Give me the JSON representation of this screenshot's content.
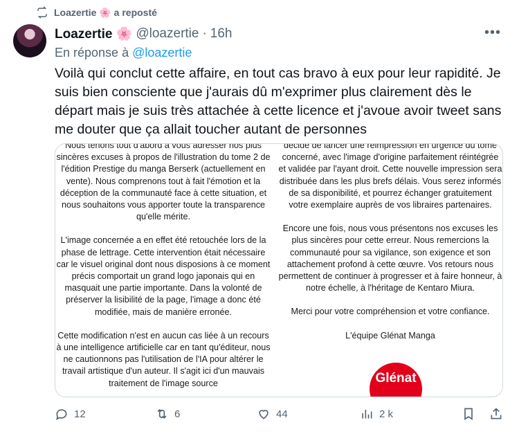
{
  "repost": {
    "label": "Loazertie 🌸 a reposté"
  },
  "post": {
    "display_name": "Loazertie 🌸",
    "handle": "@loazertie",
    "separator": "·",
    "time": "16h",
    "reply_prefix": "En réponse à",
    "reply_to": "@loazertie",
    "text": "Voilà qui conclut cette affaire, en tout cas bravo à eux pour leur rapidité. Je suis bien consciente que j'aurais dû m'exprimer plus clairement dès le départ mais je suis très attachée à cette licence et j'avoue avoir tweet sans me douter que ça allait toucher autant de personnes"
  },
  "media": {
    "left_paragraphs": [
      "Nous tenons tout d'abord à vous adresser nos plus sincères excuses à propos de l'illustration du tome 2 de l'édition Prestige du manga Berserk (actuellement en vente). Nous comprenons tout à fait l'émotion et la déception de la communauté face à cette situation, et nous souhaitons vous apporter toute la transparence qu'elle mérite.",
      "L'image concernée a en effet été retouchée lors de la phase de lettrage. Cette intervention était nécessaire car le visuel original dont nous disposions à ce moment précis comportait un grand logo japonais qui en masquait une partie importante. Dans la volonté de préserver la lisibilité de la page, l'image a donc été modifiée, mais de manière erronée.",
      "Cette modification n'est en aucun cas liée à un recours à une intelligence artificielle car en tant qu'éditeur, nous ne cautionnons pas l'utilisation de l'IA pour altérer le travail artistique d'un auteur. Il s'agit ici d'un mauvais traitement de l'image source"
    ],
    "right_paragraphs": [
      "décidé de lancer une réimpression en urgence du tome concerné, avec l'image d'origine parfaitement réintégrée et validée par l'ayant droit. Cette nouvelle impression sera distribuée dans les plus brefs délais. Vous serez informés de sa disponibilité, et pourrez échanger gratuitement votre exemplaire auprès de vos libraires partenaires.",
      "Encore une fois, nous vous présentons nos excuses les plus sincères pour cette erreur. Nous remercions la communauté pour sa vigilance, son exigence et son attachement profond à cette œuvre. Vos retours nous permettent de continuer à progresser et à faire honneur, à notre échelle, à l'héritage de Kentaro Miura.",
      "Merci pour votre compréhension et votre confiance.",
      "L'équipe Glénat Manga"
    ],
    "logo_text": "Glénat"
  },
  "actions": {
    "replies": "12",
    "reposts": "6",
    "likes": "44",
    "views": "2 k"
  },
  "colors": {
    "accent": "#1d9bf0",
    "muted": "#536471",
    "logo_red": "#e3001b"
  },
  "icons": [
    "repost-icon",
    "more-icon",
    "reply-icon",
    "like-icon",
    "views-icon",
    "bookmark-icon",
    "share-icon"
  ]
}
